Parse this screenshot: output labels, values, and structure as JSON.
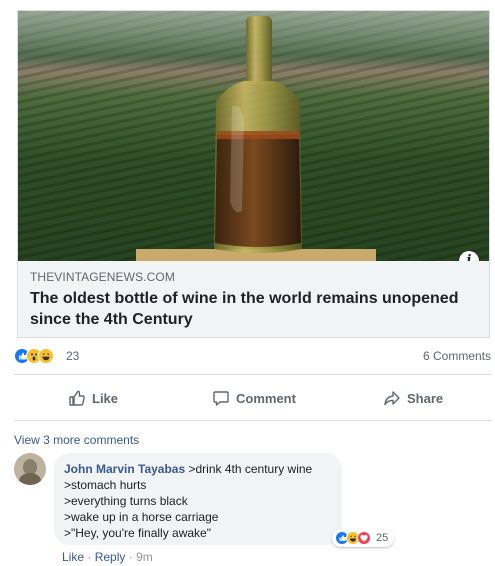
{
  "preview": {
    "domain": "THEVINTAGENEWS.COM",
    "headline": "The oldest bottle of wine in the world remains unopened since the 4th Century",
    "info_glyph": "i",
    "image": "photo-ancient-wine-bottle-in-front-of-vineyard"
  },
  "summary": {
    "reaction_icons": [
      "like-icon",
      "wow-icon",
      "haha-icon"
    ],
    "reaction_count": "23",
    "comments_count": "6 Comments"
  },
  "actions": {
    "like": "Like",
    "comment": "Comment",
    "share": "Share"
  },
  "comments_section": {
    "view_more": "View 3 more comments"
  },
  "comment": {
    "author": "John Marvin Tayabas",
    "lines": [
      ">drink 4th century wine",
      ">stomach hurts",
      ">everything turns black",
      ">wake up in a horse carriage",
      ">\"Hey, you're finally awake\""
    ],
    "reaction_icons": [
      "like-icon",
      "haha-icon",
      "love-icon"
    ],
    "reaction_count": "25",
    "like_label": "Like",
    "separator": "·",
    "reply_label": "Reply",
    "time": "9m"
  },
  "colors": {
    "link_blue": "#385898",
    "fb_blue": "#1877f2",
    "muted": "#606770",
    "card_bg": "#f2f3f5"
  }
}
